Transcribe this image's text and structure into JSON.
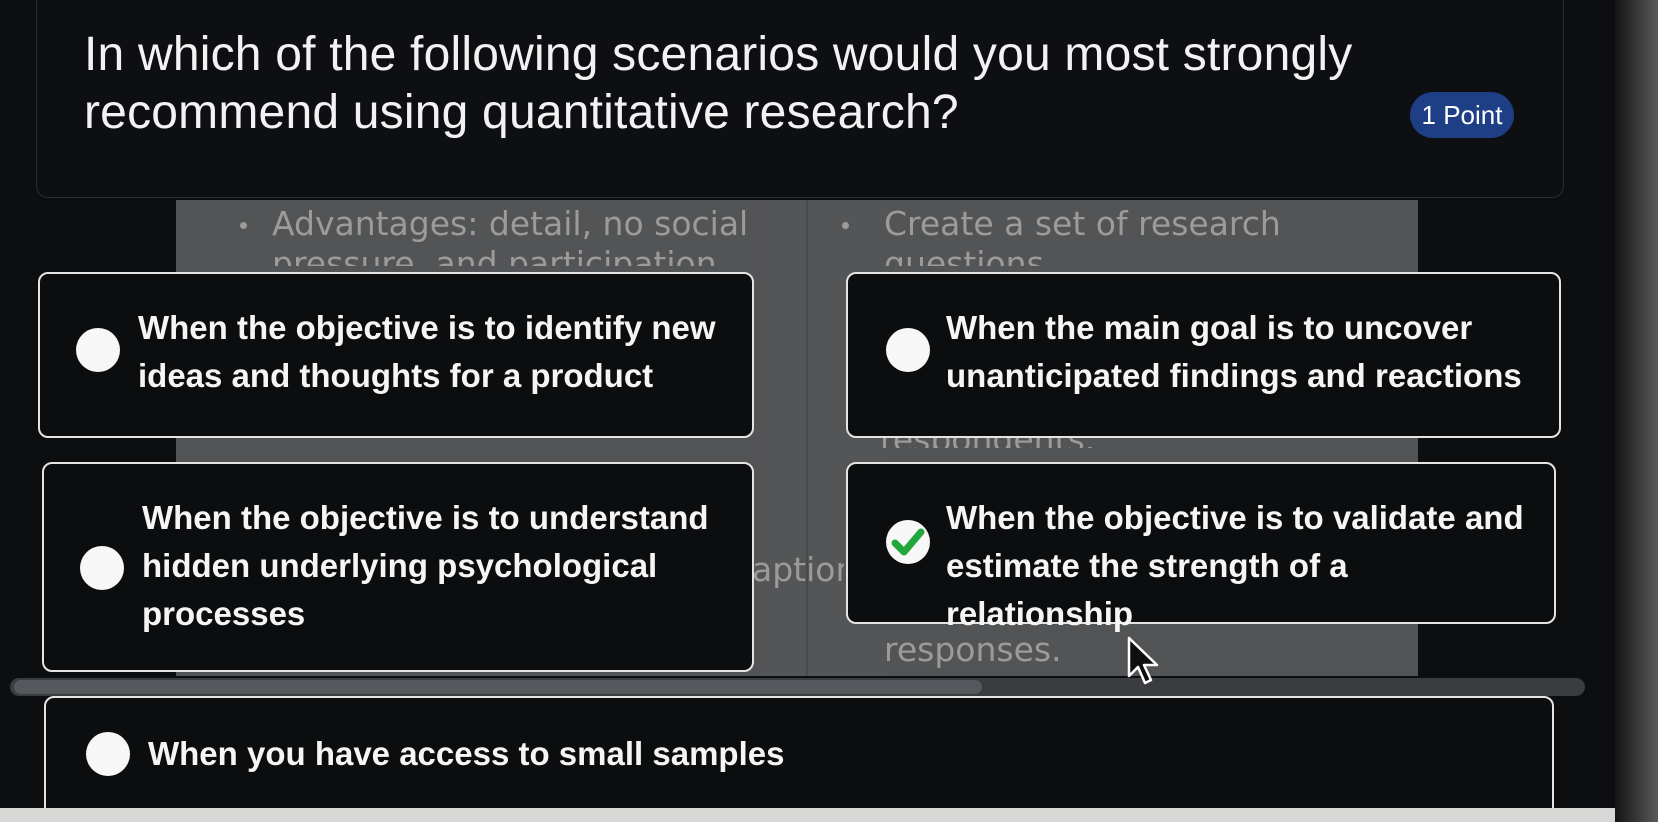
{
  "question": {
    "text": "In which of the following scenarios would you most strongly recommend using quantitative research?",
    "points": "1 Point"
  },
  "background_doc": {
    "left_bullet_line1": "Advantages: detail, no social",
    "left_bullet_line2": "pressure, and participation",
    "right_bullet_line1": "Create a set of research",
    "right_bullet_line2": "questions",
    "fragment_middle": "respondents.",
    "fragment_caption": "aption",
    "fragment_responses": "responses."
  },
  "options": [
    {
      "text": "When the objective is to identify new ideas and thoughts for a product",
      "selected": false
    },
    {
      "text": "When the main goal is to uncover unanticipated findings and reactions",
      "selected": false
    },
    {
      "text": "When the objective is to understand hidden underlying psychological processes",
      "selected": false
    },
    {
      "text": "When the objective is to validate and estimate the strength of a relationship",
      "selected": true
    },
    {
      "text": "When you have access to small samples",
      "selected": false
    }
  ],
  "colors": {
    "badge": "#1e3f86",
    "check": "#22a83a"
  }
}
